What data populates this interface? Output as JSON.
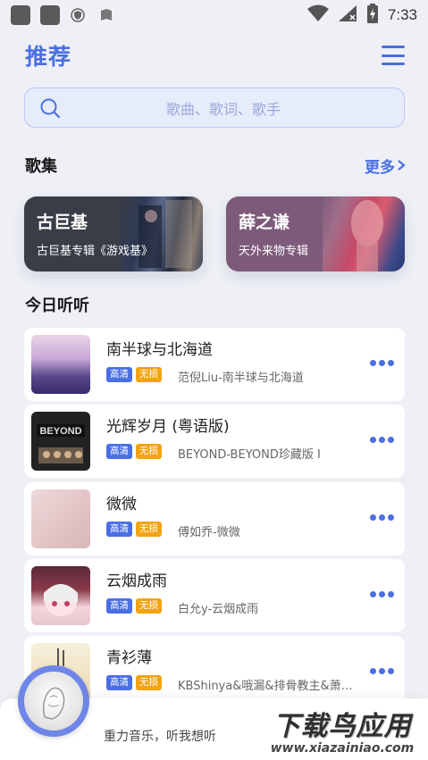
{
  "status_bar": {
    "time": "7:33",
    "icons": [
      "app-icon",
      "app-icon",
      "shield-icon",
      "book-icon",
      "wifi-icon",
      "signal-icon",
      "battery-charging-icon"
    ]
  },
  "header": {
    "title": "推荐",
    "menu_icon": "hamburger-menu-icon"
  },
  "search": {
    "placeholder": "歌曲、歌词、歌手"
  },
  "collections": {
    "title": "歌集",
    "more_label": "更多",
    "items": [
      {
        "title": "古巨基",
        "subtitle": "古巨基专辑《游戏基》"
      },
      {
        "title": "薛之谦",
        "subtitle": "天外来物专辑"
      }
    ]
  },
  "today": {
    "title": "今日听听",
    "tag_hq": "高清",
    "tag_lossless": "无损",
    "songs": [
      {
        "title": "南半球与北海道",
        "artist": "范倪Liu-南半球与北海道"
      },
      {
        "title": "光辉岁月 (粤语版)",
        "artist": "BEYOND-BEYOND珍藏版 I"
      },
      {
        "title": "微微",
        "artist": "傅如乔-微微"
      },
      {
        "title": "云烟成雨",
        "artist": "白允y-云烟成雨"
      },
      {
        "title": "青衫薄",
        "artist": "KBShinya&哦漏&排骨教主&萧…"
      }
    ]
  },
  "player": {
    "slogan": "重力音乐，听我想听"
  },
  "watermark": {
    "cn": "下载鸟应用",
    "url": "www.xiazainiao.com"
  },
  "colors": {
    "accent": "#4a6fe3",
    "lossless": "#f2a413",
    "background": "#eef0f6"
  }
}
